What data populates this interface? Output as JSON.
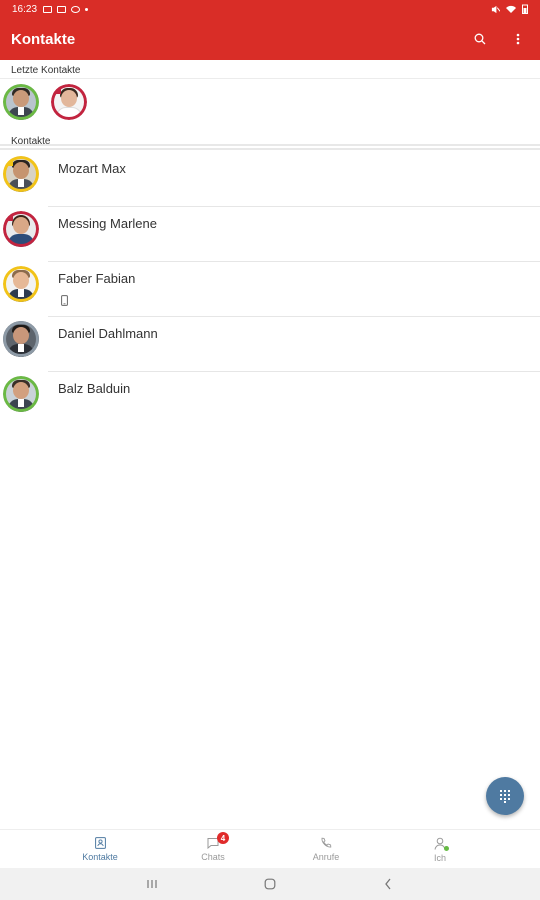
{
  "status_bar": {
    "time": "16:23"
  },
  "app_bar": {
    "title": "Kontakte",
    "search_icon": "search-icon",
    "menu_icon": "more-vert-icon"
  },
  "recent": {
    "header": "Letzte Kontakte",
    "avatars": [
      {
        "status_color": "#6bb944"
      },
      {
        "status_color": "#c2243f"
      }
    ]
  },
  "contacts": {
    "header": "Kontakte",
    "items": [
      {
        "name": "Mozart Max",
        "status_color": "#f2c318"
      },
      {
        "name": "Messing Marlene",
        "status_color": "#c2243f"
      },
      {
        "name": "Faber Fabian",
        "status_color": "#f2c318",
        "sub_icon": "mobile-phone-icon"
      },
      {
        "name": "Daniel Dahlmann",
        "status_color": "#8d9aa6"
      },
      {
        "name": "Balz Balduin",
        "status_color": "#6bb944"
      }
    ]
  },
  "fab": {
    "icon": "dialpad-icon",
    "color": "#4f7aa1"
  },
  "bottom_nav": {
    "items": [
      {
        "label": "Kontakte",
        "icon": "contacts-icon",
        "active": true
      },
      {
        "label": "Chats",
        "icon": "chat-icon",
        "badge": "4"
      },
      {
        "label": "Anrufe",
        "icon": "phone-icon"
      },
      {
        "label": "Ich",
        "icon": "person-icon"
      }
    ]
  },
  "colors": {
    "primary": "#d92d27",
    "accent": "#4f7aa1",
    "badge": "#e02b2b"
  }
}
